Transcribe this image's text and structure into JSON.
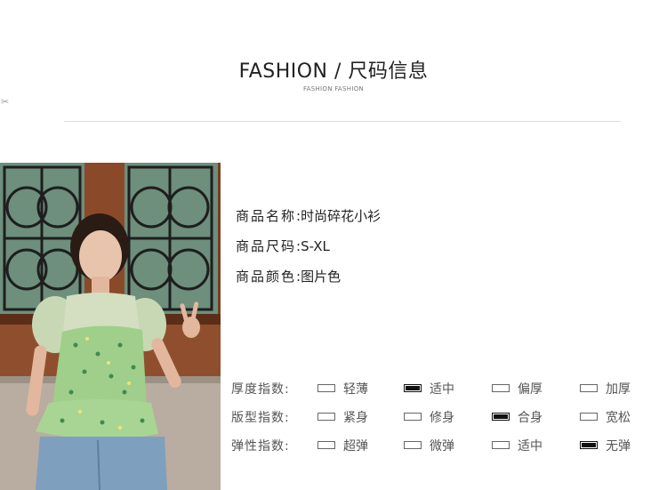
{
  "header": {
    "title": "FASHION / 尺码信息",
    "subtitle": "FASHION FASHION"
  },
  "product": {
    "rows": [
      {
        "label": "商品名称",
        "value": ":时尚碎花小衫"
      },
      {
        "label": "商品尺码",
        "value": ":S-XL"
      },
      {
        "label": "商品颜色",
        "value": ":图片色"
      }
    ]
  },
  "specs": [
    {
      "label": "厚度指数:",
      "options": [
        {
          "text": "轻薄",
          "selected": false
        },
        {
          "text": "适中",
          "selected": true
        },
        {
          "text": "偏厚",
          "selected": false
        },
        {
          "text": "加厚",
          "selected": false
        }
      ]
    },
    {
      "label": "版型指数:",
      "options": [
        {
          "text": "紧身",
          "selected": false
        },
        {
          "text": "修身",
          "selected": false
        },
        {
          "text": "合身",
          "selected": true
        },
        {
          "text": "宽松",
          "selected": false
        }
      ]
    },
    {
      "label": "弹性指数:",
      "options": [
        {
          "text": "超弹",
          "selected": false
        },
        {
          "text": "微弹",
          "selected": false
        },
        {
          "text": "适中",
          "selected": false
        },
        {
          "text": "无弹",
          "selected": true
        }
      ]
    }
  ],
  "icons": {
    "scissor": "✂"
  },
  "colors": {
    "top_fabric": "#9fcf8a",
    "window_frame": "#8a4a2a",
    "selected_box": "#111111"
  }
}
